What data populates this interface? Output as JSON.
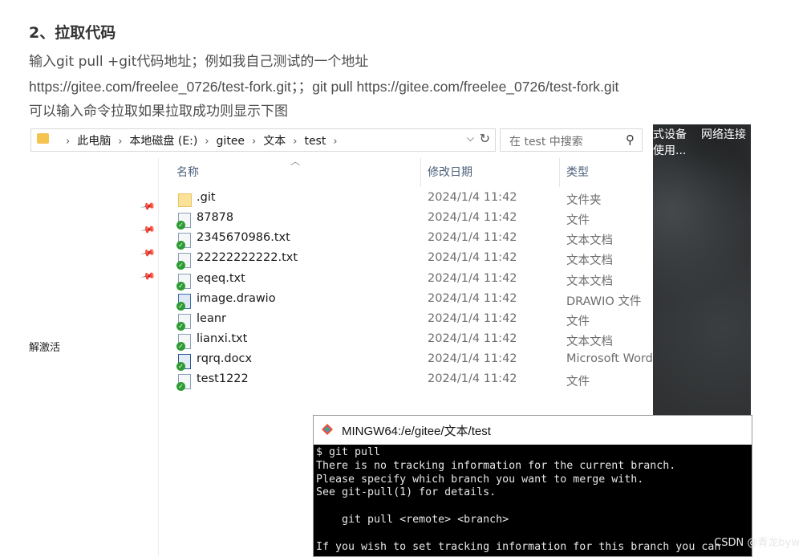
{
  "article": {
    "heading": "2、拉取代码",
    "para1": "输入git pull +git代码地址；例如我自己测试的一个地址",
    "para2": "https://gitee.com/freelee_0726/test-fork.git；；git pull https://gitee.com/freelee_0726/test-fork.git",
    "para3": "可以输入命令拉取如果拉取成功则显示下图"
  },
  "explorer": {
    "breadcrumbs": [
      "此电脑",
      "本地磁盘 (E:)",
      "gitee",
      "文本",
      "test"
    ],
    "search_placeholder": "在 test 中搜索",
    "columns": {
      "name": "名称",
      "date": "修改日期",
      "type": "类型"
    },
    "files": [
      {
        "name": ".git",
        "date": "2024/1/4 11:42",
        "type": "文件夹",
        "icon": "folder-icon"
      },
      {
        "name": "87878",
        "date": "2024/1/4 11:42",
        "type": "文件",
        "icon": "file-checked-icon"
      },
      {
        "name": "2345670986.txt",
        "date": "2024/1/4 11:42",
        "type": "文本文档",
        "icon": "text-file-checked-icon"
      },
      {
        "name": "22222222222.txt",
        "date": "2024/1/4 11:42",
        "type": "文本文档",
        "icon": "text-file-checked-icon"
      },
      {
        "name": "eqeq.txt",
        "date": "2024/1/4 11:42",
        "type": "文本文档",
        "icon": "text-file-checked-icon"
      },
      {
        "name": "image.drawio",
        "date": "2024/1/4 11:42",
        "type": "DRAWIO 文件",
        "icon": "drawio-file-checked-icon"
      },
      {
        "name": "leanr",
        "date": "2024/1/4 11:42",
        "type": "文件",
        "icon": "file-checked-icon"
      },
      {
        "name": "lianxi.txt",
        "date": "2024/1/4 11:42",
        "type": "文本文档",
        "icon": "text-file-checked-icon"
      },
      {
        "name": "rqrq.docx",
        "date": "2024/1/4 11:42",
        "type": "Microsoft Word",
        "icon": "word-file-checked-icon"
      },
      {
        "name": "test1222",
        "date": "2024/1/4 11:42",
        "type": "文件",
        "icon": "file-checked-icon"
      }
    ],
    "side_label": "解激活"
  },
  "desktop": {
    "label1": "式设备",
    "label2": "网络连接",
    "label3": "使用..."
  },
  "terminal": {
    "title": "MINGW64:/e/gitee/文本/test",
    "lines": [
      "$ git pull",
      "There is no tracking information for the current branch.",
      "Please specify which branch you want to merge with.",
      "See git-pull(1) for details.",
      "",
      "    git pull <remote> <branch>",
      "",
      "If you wish to set tracking information for this branch you can"
    ]
  },
  "watermark": "CSDN @青龙byw"
}
